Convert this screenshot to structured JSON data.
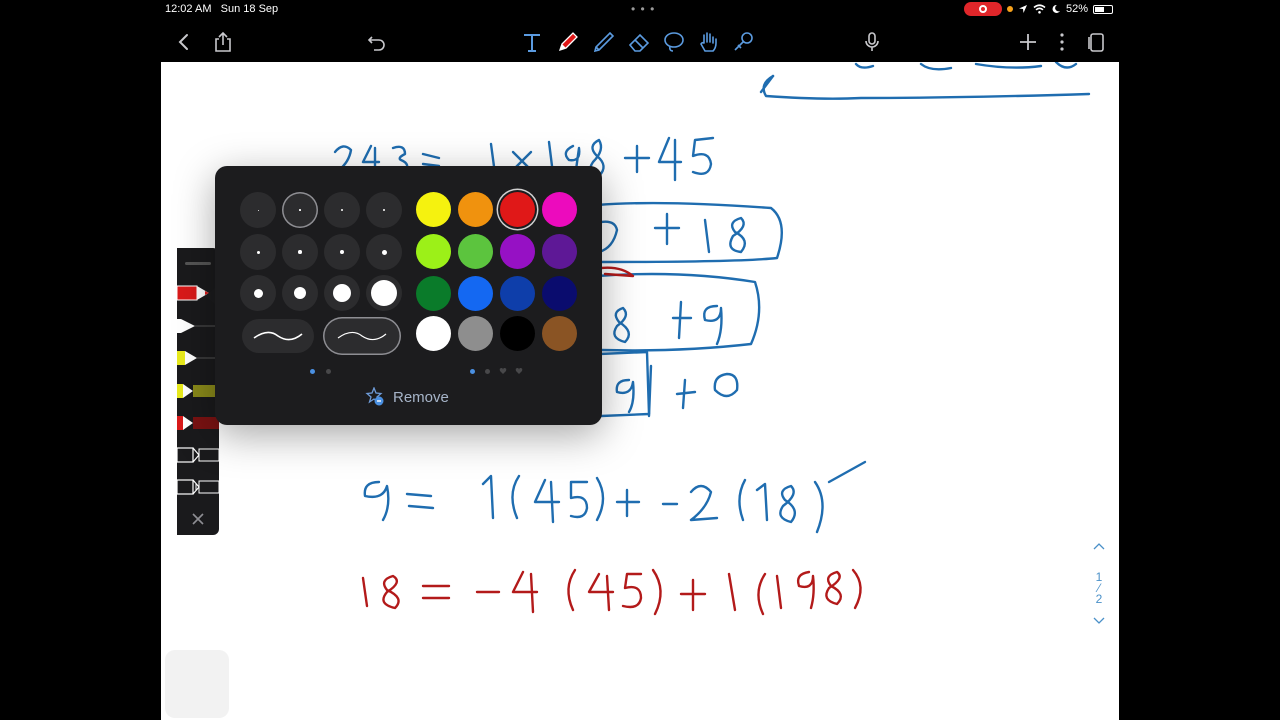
{
  "status_bar": {
    "time": "12:02 AM",
    "date": "Sun 18 Sep",
    "battery": "52%"
  },
  "toolbar": {
    "left_icons": [
      "back-icon",
      "share-icon",
      "undo-icon"
    ],
    "center_tools": [
      "text-tool-icon",
      "pen-tool-icon",
      "highlighter-tool-icon",
      "eraser-tool-icon",
      "lasso-tool-icon",
      "hand-tool-icon",
      "shape-tool-icon"
    ],
    "right_icons": [
      "microphone-icon",
      "add-icon",
      "more-icon",
      "pages-icon"
    ]
  },
  "popup": {
    "remove_label": "Remove",
    "colors": [
      [
        "#f5f20f",
        "#f0920e",
        "#e01818",
        "#ec0bbd"
      ],
      [
        "#9cf018",
        "#5cc43e",
        "#9611c4",
        "#5e1896"
      ],
      [
        "#0a7b2a",
        "#1468f2",
        "#0e3eaa",
        "#0a0c6e"
      ],
      [
        "#ffffff",
        "#8e8e8e",
        "#000000",
        "#8a5424"
      ]
    ],
    "selected_color": "#e01818",
    "selected_size_index": 1,
    "selected_stroke_index": 1
  },
  "page_indicator": {
    "current": "1",
    "total": "2"
  },
  "handwriting": {
    "ink_blue": "#1f6db0",
    "ink_red": "#b31a1a"
  }
}
